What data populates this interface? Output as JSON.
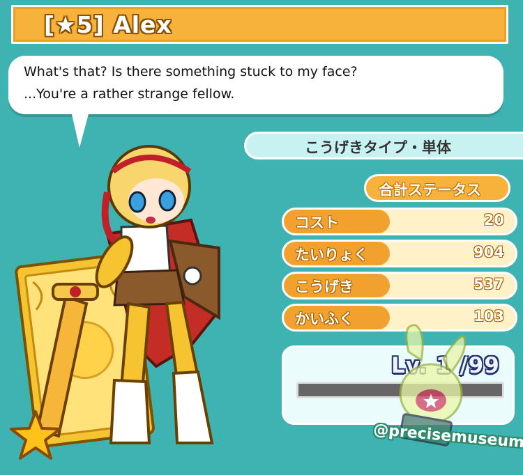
{
  "title": {
    "text": "[★5] Alex"
  },
  "dialogue": {
    "line1": "What's that? Is there something stuck to my face?",
    "line2": "...You're a rather strange fellow."
  },
  "card": {
    "type_label": "こうげきタイプ・単体",
    "total_status_label": "合計ステータス",
    "stats": [
      {
        "label": "コスト",
        "value": "20"
      },
      {
        "label": "たいりょく",
        "value": "904"
      },
      {
        "label": "こうげき",
        "value": "537"
      },
      {
        "label": "かいふく",
        "value": "103"
      }
    ],
    "level_text": "Lv. 1 /99",
    "exp_fraction": 0,
    "rarity_icon": "star-icon"
  },
  "watermark": {
    "text": "@precisemuseum"
  },
  "colors": {
    "background": "#3fb3b1",
    "title_bar": "#f7b23b",
    "stat_label": "#f2a02e",
    "type_bar": "#c8f2f1"
  }
}
